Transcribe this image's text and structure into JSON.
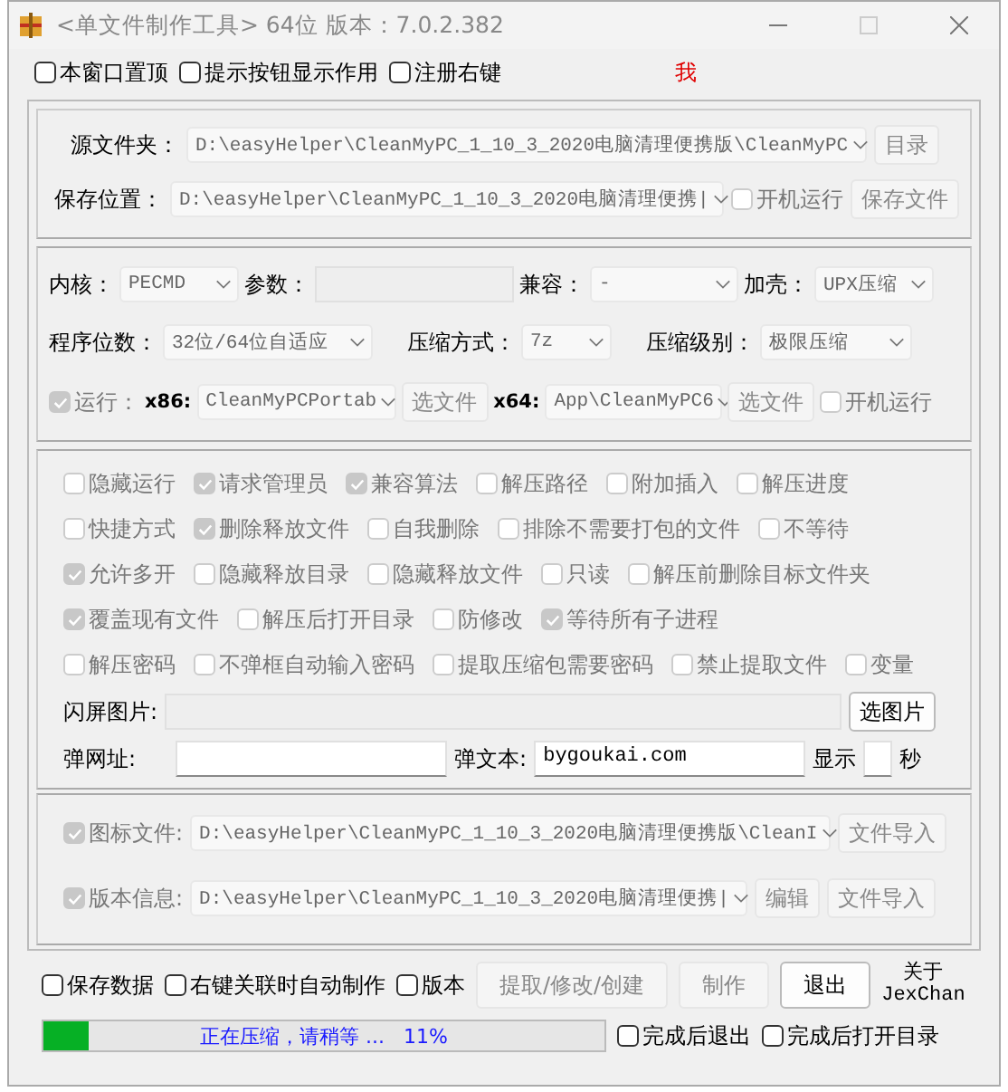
{
  "window": {
    "title": "<单文件制作工具> 64位 版本：7.0.2.382"
  },
  "top_options": [
    {
      "label": "本窗口置顶",
      "checked": false
    },
    {
      "label": "提示按钮显示作用",
      "checked": false
    },
    {
      "label": "注册右键",
      "checked": false
    }
  ],
  "red_mark": "我",
  "paths": {
    "source_label": "源文件夹：",
    "source_value": "D:\\easyHelper\\CleanMyPC_1_10_3_2020电脑清理便携版\\CleanMyPC",
    "source_button": "目录",
    "save_label": "保存位置：",
    "save_value": "D:\\easyHelper\\CleanMyPC_1_10_3_2020电脑清理便携|",
    "autostart": {
      "label": "开机运行",
      "checked": false
    },
    "save_button": "保存文件"
  },
  "settings": {
    "kernel_label": "内核：",
    "kernel": "PECMD",
    "params_label": "参数：",
    "compat_label": "兼容：",
    "compat": "-",
    "shell_label": "加壳：",
    "shell": "UPX压缩",
    "bits_label": "程序位数：",
    "bits": "32位/64位自适应",
    "method_label": "压缩方式：",
    "method": "7z",
    "level_label": "压缩级别：",
    "level_value": "极限压缩"
  },
  "run": {
    "label": "运行：",
    "checked": true,
    "x86_label": "x86:",
    "x86": "CleanMyPCPortab",
    "x86_button": "选文件",
    "x64_label": "x64:",
    "x64": "App\\CleanMyPC6",
    "x64_button": "选文件",
    "autostart": {
      "label": "开机运行",
      "checked": false
    }
  },
  "option_rows": [
    [
      {
        "label": "隐藏运行",
        "checked": false
      },
      {
        "label": "请求管理员",
        "checked": true
      },
      {
        "label": "兼容算法",
        "checked": true
      },
      {
        "label": "解压路径",
        "checked": false
      },
      {
        "label": "附加插入",
        "checked": false
      },
      {
        "label": "解压进度",
        "checked": false
      }
    ],
    [
      {
        "label": "快捷方式",
        "checked": false
      },
      {
        "label": "删除释放文件",
        "checked": true
      },
      {
        "label": "自我删除",
        "checked": false
      },
      {
        "label": "排除不需要打包的文件",
        "checked": false
      },
      {
        "label": "不等待",
        "checked": false
      }
    ],
    [
      {
        "label": "允许多开",
        "checked": true
      },
      {
        "label": "隐藏释放目录",
        "checked": false
      },
      {
        "label": "隐藏释放文件",
        "checked": false
      },
      {
        "label": "只读",
        "checked": false
      },
      {
        "label": "解压前删除目标文件夹",
        "checked": false
      }
    ],
    [
      {
        "label": "覆盖现有文件",
        "checked": true
      },
      {
        "label": "解压后打开目录",
        "checked": false
      },
      {
        "label": "防修改",
        "checked": false
      },
      {
        "label": "等待所有子进程",
        "checked": true
      }
    ],
    [
      {
        "label": "解压密码",
        "checked": false
      },
      {
        "label": "不弹框自动输入密码",
        "checked": false
      },
      {
        "label": "提取压缩包需要密码",
        "checked": false
      },
      {
        "label": "禁止提取文件",
        "checked": false
      },
      {
        "label": "变量",
        "checked": false
      }
    ]
  ],
  "splash": {
    "label": "闪屏图片:",
    "button": "选图片"
  },
  "popup": {
    "url_label": "弹网址:",
    "text_label": "弹文本:",
    "text_value": "bygoukai.com",
    "show_label": "显示",
    "seconds_label": "秒"
  },
  "resources": [
    {
      "label": "图标文件:",
      "checked": true,
      "value": "D:\\easyHelper\\CleanMyPC_1_10_3_2020电脑清理便携版\\CleanI",
      "buttons": [
        "文件导入"
      ]
    },
    {
      "label": "版本信息:",
      "checked": true,
      "value": "D:\\easyHelper\\CleanMyPC_1_10_3_2020电脑清理便携|",
      "buttons": [
        "编辑",
        "文件导入"
      ]
    }
  ],
  "bottom_options": [
    {
      "label": "保存数据",
      "checked": false
    },
    {
      "label": "右键关联时自动制作",
      "checked": false
    },
    {
      "label": "版本",
      "checked": false
    }
  ],
  "actions": [
    {
      "label": "提取/修改/创建",
      "disabled": true
    },
    {
      "label": "制作",
      "disabled": true
    },
    {
      "label": "退出",
      "disabled": false
    }
  ],
  "about": [
    "关于",
    "JexChan"
  ],
  "progress": {
    "level": 0.08,
    "text": "正在压缩，请稍等 ...   11%"
  },
  "finish_options": [
    {
      "label": "完成后退出",
      "checked": false
    },
    {
      "label": "完成后打开目录",
      "checked": false
    }
  ]
}
